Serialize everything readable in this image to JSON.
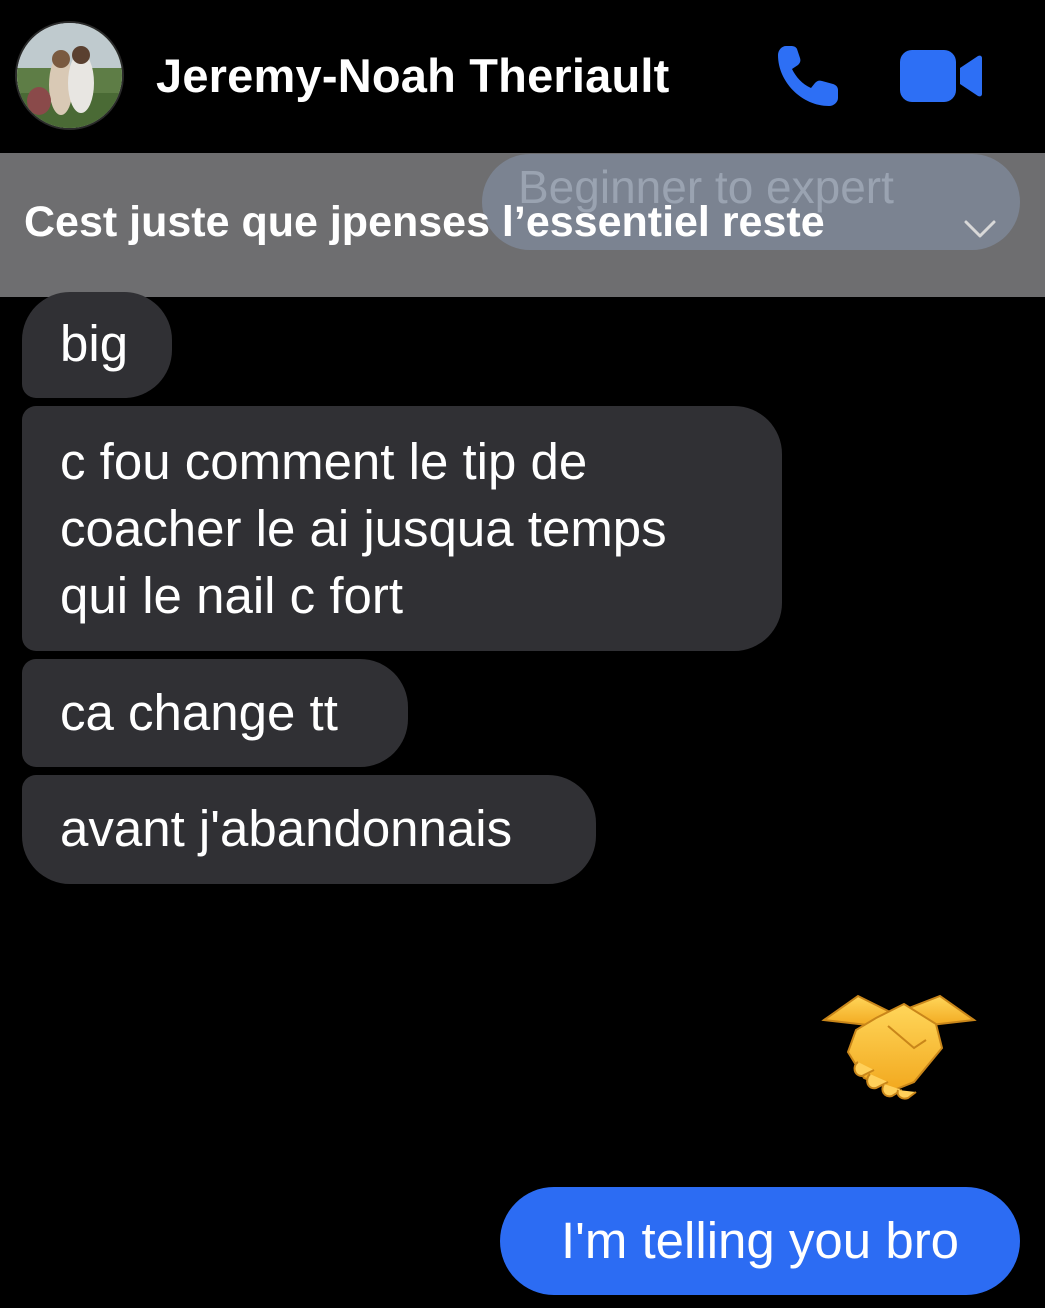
{
  "header": {
    "contact_name": "Jeremy-Noah Theriault",
    "call_icon": "phone-icon",
    "video_icon": "video-camera-icon"
  },
  "pinned": {
    "text": "Cest juste que jpenses l’essentiel reste",
    "ghost_text": "Beginner to expert",
    "chevron_icon": "chevron-down-icon"
  },
  "messages": {
    "incoming": [
      {
        "lines": [
          "big"
        ]
      },
      {
        "lines": [
          "c fou comment le tip de",
          "coacher le ai jusqua temps",
          "qui le nail c fort"
        ]
      },
      {
        "lines": [
          "ca change tt"
        ]
      },
      {
        "lines": [
          "avant j'abandonnais"
        ]
      }
    ],
    "reaction_emoji": "handshake-emoji",
    "outgoing": [
      {
        "text": "I'm telling you bro"
      }
    ]
  },
  "colors": {
    "background": "#000000",
    "incoming_bubble": "#303034",
    "outgoing_bubble": "#2c6cf3",
    "accent_icon": "#2d6ff5",
    "banner": "#6e6e70"
  }
}
